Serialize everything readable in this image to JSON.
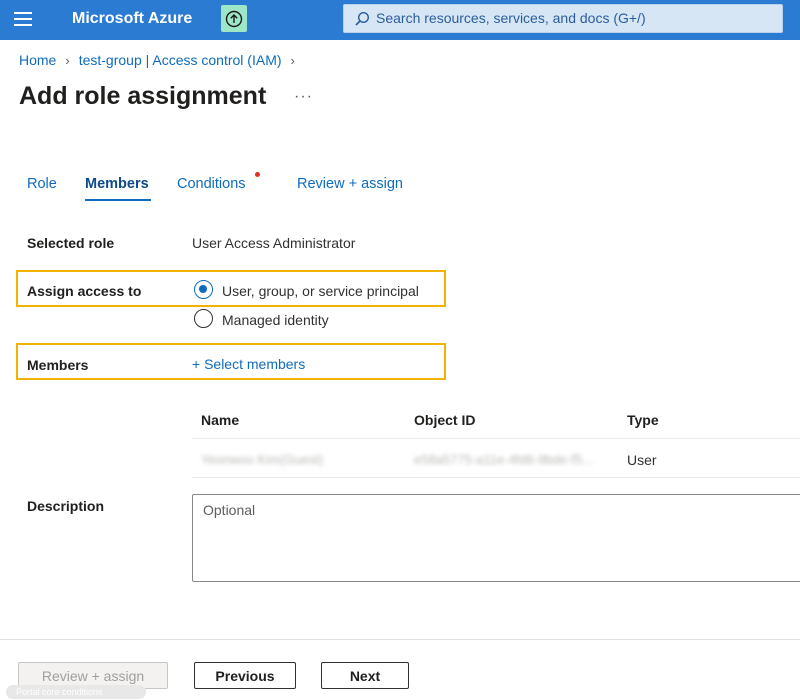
{
  "header": {
    "brand": "Microsoft Azure",
    "search_placeholder": "Search resources, services, and docs (G+/)",
    "accent": "#2b7bd3"
  },
  "breadcrumb": {
    "home": "Home",
    "group": "test-group | Access control (IAM)"
  },
  "page": {
    "title": "Add role assignment",
    "more": "···"
  },
  "tabs": {
    "role": "Role",
    "members": "Members",
    "conditions": "Conditions",
    "review": "Review + assign"
  },
  "form": {
    "selected_role_label": "Selected role",
    "selected_role_value": "User Access Administrator",
    "assign_access_label": "Assign access to",
    "option_user": "User, group, or service principal",
    "option_managed": "Managed identity",
    "members_label": "Members",
    "select_members": "+ Select members",
    "description_label": "Description",
    "description_placeholder": "Optional"
  },
  "members_table": {
    "headers": [
      "Name",
      "Object ID",
      "Type"
    ],
    "rows": [
      {
        "name": "Yeonwoo Kim(Guest)",
        "object_id": "e58a5775-a11e-4fd6-9bde-f5...",
        "type": "User"
      }
    ]
  },
  "footer": {
    "review_assign": "Review + assign",
    "previous": "Previous",
    "next": "Next",
    "ghost_text": "Portal core conditions"
  }
}
